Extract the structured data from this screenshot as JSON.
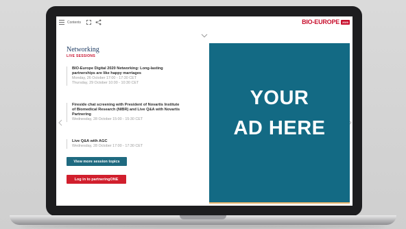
{
  "topbar": {
    "contents_label": "Contents",
    "brand_name": "BIO-EUROPE",
    "brand_badge": "2020"
  },
  "networking": {
    "title": "Networking",
    "subtitle": "LIVE SESSIONS",
    "sessions": [
      {
        "title_lines": [
          "BIO-Europe Digital 2020 Networking: Long-lasting",
          "partnerships are like happy marriages"
        ],
        "time_lines": [
          "Monday, 26 October 17:00 - 17:30 CET",
          "Thursday, 29 October 10:00 - 10:30 CET"
        ]
      },
      {
        "title_lines": [
          "Fireside chat screening with President of Novartis Institute",
          "of Biomedical Research (NIBR) and Live Q&A with Novartis",
          "Partnering"
        ],
        "time_lines": [
          "Wednesday, 28 October 15:00 - 15:30 CET"
        ]
      },
      {
        "title_lines": [
          "Live Q&A with AGC"
        ],
        "time_lines": [
          "Wednesday, 28 October 17:00 - 17:30 CET"
        ]
      }
    ],
    "view_more_label": "View more session topics",
    "login_label": "Log in to partneringONE"
  },
  "ad": {
    "line1": "YOUR",
    "line2": "AD HERE"
  },
  "colors": {
    "brand_red": "#c8102e",
    "ad_teal": "#136a84",
    "button_teal": "#1f6a80",
    "button_red": "#d11f2d",
    "title_navy": "#1d3b63"
  },
  "icons": [
    "menu-icon",
    "expand-icon",
    "share-icon",
    "chevron-down-icon",
    "chevron-left-icon",
    "chevron-right-icon"
  ]
}
